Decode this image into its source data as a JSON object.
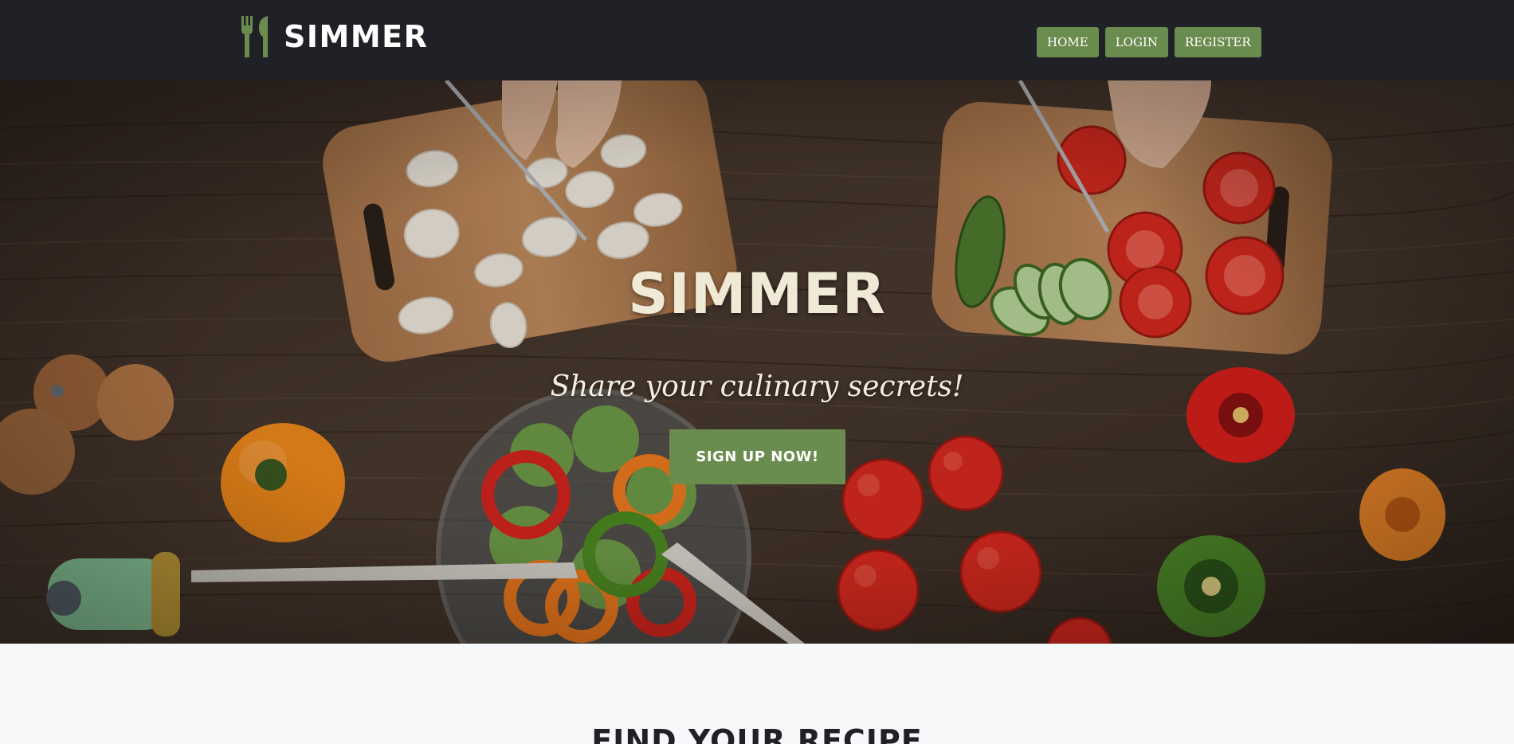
{
  "brand": {
    "name": "SIMMER",
    "icon": "fork-knife-icon",
    "icon_color": "#6a8c4f"
  },
  "nav": {
    "items": [
      {
        "label": "HOME"
      },
      {
        "label": "LOGIN"
      },
      {
        "label": "REGISTER"
      }
    ],
    "button_color": "#6a8c4f",
    "bar_color": "#1f2126"
  },
  "hero": {
    "title": "SIMMER",
    "tagline": "Share your culinary secrets!",
    "cta_label": "SIGN UP NOW!"
  },
  "find_section": {
    "title": "FIND YOUR RECIPE"
  }
}
